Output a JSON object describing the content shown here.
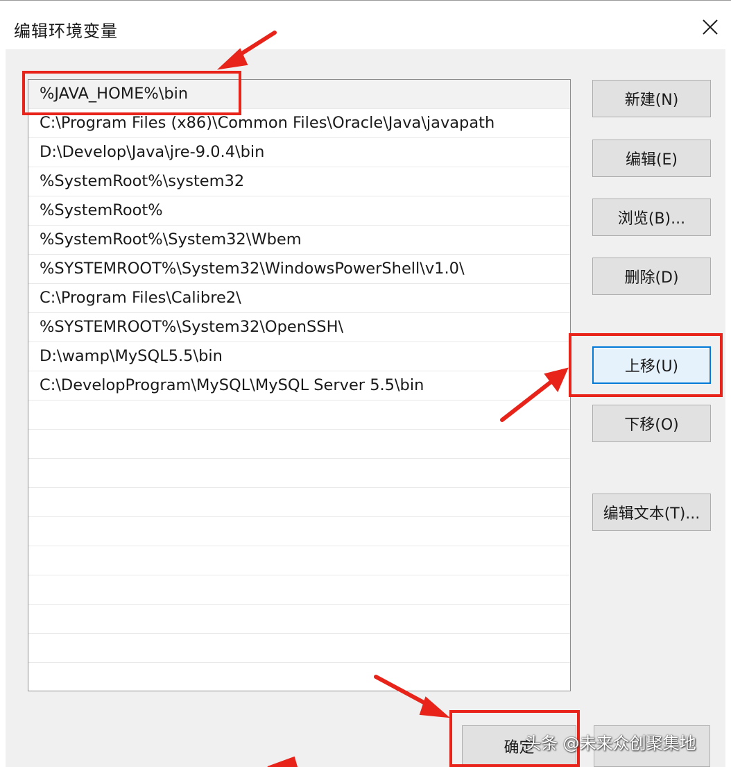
{
  "window": {
    "title": "编辑环境变量"
  },
  "paths": [
    "%JAVA_HOME%\\bin",
    "C:\\Program Files (x86)\\Common Files\\Oracle\\Java\\javapath",
    "D:\\Develop\\Java\\jre-9.0.4\\bin",
    "%SystemRoot%\\system32",
    "%SystemRoot%",
    "%SystemRoot%\\System32\\Wbem",
    "%SYSTEMROOT%\\System32\\WindowsPowerShell\\v1.0\\",
    "C:\\Program Files\\Calibre2\\",
    "%SYSTEMROOT%\\System32\\OpenSSH\\",
    "D:\\wamp\\MySQL5.5\\bin",
    "C:\\DevelopProgram\\MySQL\\MySQL Server 5.5\\bin"
  ],
  "buttons": {
    "new": "新建(N)",
    "edit": "编辑(E)",
    "browse": "浏览(B)...",
    "delete": "删除(D)",
    "move_up": "上移(U)",
    "move_down": "下移(O)",
    "edit_text": "编辑文本(T)...",
    "ok": "确定",
    "cancel": ""
  },
  "watermark": "头条 @未来众创聚集地",
  "colors": {
    "callout": "#e8241a",
    "focus": "#0078d7",
    "button_face": "#e1e1e1",
    "dialog_bg": "#f0f0f0"
  }
}
